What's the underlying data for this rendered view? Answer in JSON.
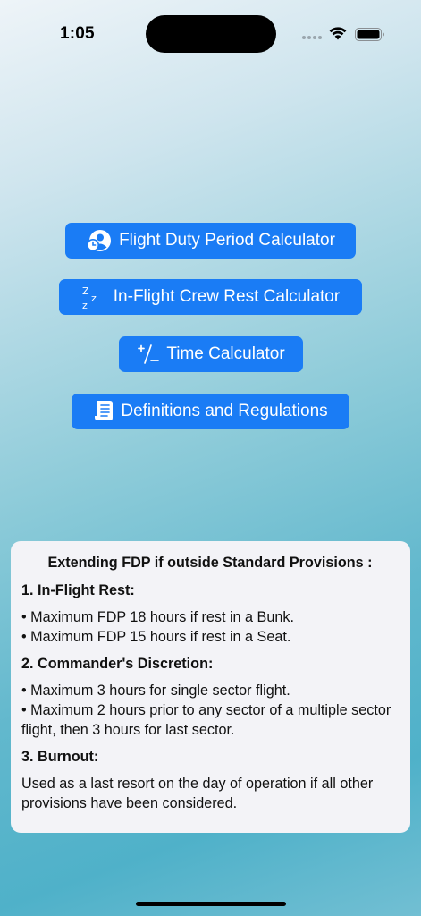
{
  "status_bar": {
    "time": "1:05"
  },
  "menu": {
    "buttons": [
      {
        "label": "Flight Duty Period Calculator",
        "icon": "person-clock-icon"
      },
      {
        "label": "In-Flight Crew Rest Calculator",
        "icon": "zzz-sleep-icon"
      },
      {
        "label": "Time Calculator",
        "icon": "plus-minus-icon"
      },
      {
        "label": "Definitions and Regulations",
        "icon": "document-icon"
      }
    ],
    "accent_color": "#1a7cf5"
  },
  "info_card": {
    "title": "Extending FDP if outside Standard Provisions :",
    "sections": [
      {
        "heading": "1. In-Flight Rest:",
        "lines": [
          "• Maximum FDP 18 hours if rest in a Bunk.",
          "• Maximum FDP 15 hours if rest in a Seat."
        ]
      },
      {
        "heading": "2. Commander's Discretion:",
        "lines": [
          "• Maximum 3 hours for single sector flight.",
          "• Maximum 2 hours prior to any sector of a multiple sector flight, then 3 hours for last sector."
        ]
      },
      {
        "heading": "3. Burnout:",
        "lines": [
          "Used as a last resort on the day of operation if all other provisions have been considered."
        ]
      }
    ]
  }
}
